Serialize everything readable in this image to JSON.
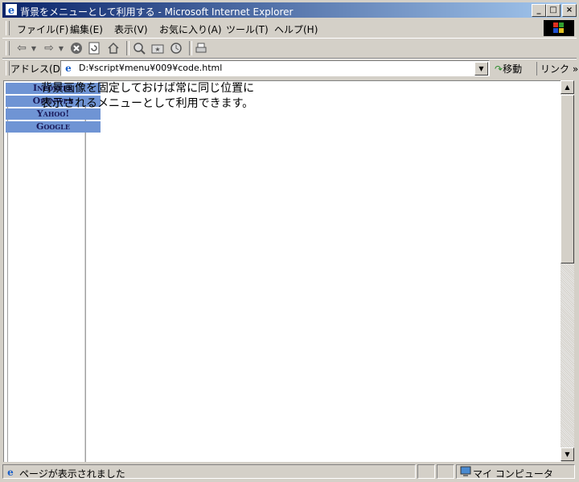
{
  "window": {
    "title": "背景をメニューとして利用する - Microsoft Internet Explorer",
    "controls": {
      "minimize": "_",
      "maximize": "□",
      "close": "×"
    }
  },
  "menubar": {
    "items": [
      "ファイル(F)",
      "編集(E)",
      "表示(V)",
      "お気に入り(A)",
      "ツール(T)",
      "ヘルプ(H)"
    ]
  },
  "toolbar": {
    "icons": [
      "back-arrow",
      "back-dropdown",
      "forward-arrow",
      "forward-dropdown",
      "stop",
      "refresh",
      "home",
      "search",
      "favorites",
      "history",
      "print"
    ]
  },
  "address_bar": {
    "label": "アドレス(D)",
    "url": "D:¥script¥menu¥009¥code.html",
    "go_label": "移動",
    "links_label": "リンク »"
  },
  "page": {
    "menu_links": [
      "Infoseek",
      "Openweb",
      "Yahoo!",
      "Google"
    ],
    "text_line1": "背景画像を固定しておけば常に同じ位置に",
    "text_line2": "表示されるメニューとして利用できます。"
  },
  "status_bar": {
    "message": "ページが表示されました",
    "zone": "マイ コンピュータ"
  },
  "colors": {
    "titlebar_start": "#0a246a",
    "titlebar_end": "#a6caf0",
    "menu_link_bg": "#6f94d4"
  }
}
